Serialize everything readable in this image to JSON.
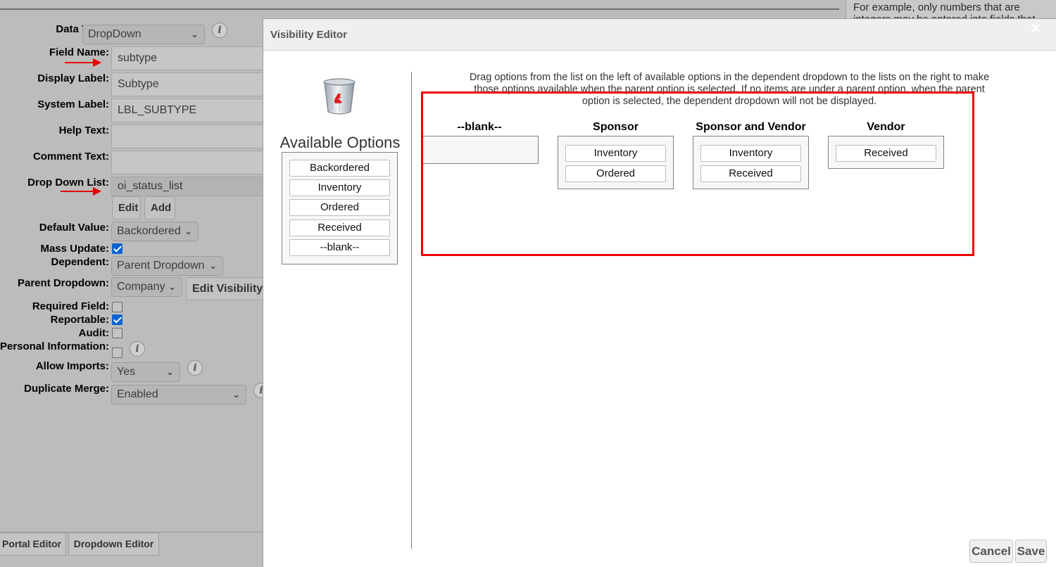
{
  "background": {
    "help_text": "For example, only numbers that are integers may be entered into fields that",
    "form": {
      "data_type": {
        "label": "Data Type:",
        "value": "DropDown"
      },
      "field_name": {
        "label": "Field Name:",
        "value": "subtype"
      },
      "display_label": {
        "label": "Display Label:",
        "value": "Subtype"
      },
      "system_label": {
        "label": "System Label:",
        "value": "LBL_SUBTYPE"
      },
      "help_text": {
        "label": "Help Text:",
        "value": ""
      },
      "comment_text": {
        "label": "Comment Text:",
        "value": ""
      },
      "drop_down_list": {
        "label": "Drop Down List:",
        "value": "oi_status_list",
        "edit": "Edit",
        "add": "Add"
      },
      "default_value": {
        "label": "Default Value:",
        "value": "Backordered"
      },
      "mass_update": {
        "label": "Mass Update:",
        "checked": true
      },
      "dependent": {
        "label": "Dependent:",
        "value": "Parent Dropdown"
      },
      "parent_dropdown": {
        "label": "Parent Dropdown:",
        "value": "Company",
        "edit_visibility": "Edit Visibility"
      },
      "required_field": {
        "label": "Required Field:",
        "checked": false
      },
      "reportable": {
        "label": "Reportable:",
        "checked": true
      },
      "audit": {
        "label": "Audit:",
        "checked": false
      },
      "personal_information": {
        "label": "Personal Information:",
        "checked": false
      },
      "allow_imports": {
        "label": "Allow Imports:",
        "value": "Yes"
      },
      "duplicate_merge": {
        "label": "Duplicate Merge:",
        "value": "Enabled"
      }
    },
    "bottom_buttons": [
      "Portal Editor",
      "Dropdown Editor"
    ]
  },
  "dialog": {
    "title": "Visibility Editor",
    "close": "×",
    "instructions": "Drag options from the list on the left of available options in the dependent dropdown to the lists on the right to make those options available when the parent option is selected. If no items are under a parent option, when the parent option is selected, the dependent dropdown will not be displayed.",
    "available": {
      "title": "Available Options",
      "options": [
        "Backordered",
        "Inventory",
        "Ordered",
        "Received",
        "--blank--"
      ]
    },
    "parent_options": [
      {
        "name": "--blank--",
        "items": []
      },
      {
        "name": "Sponsor",
        "items": [
          "Inventory",
          "Ordered"
        ]
      },
      {
        "name": "Sponsor and Vendor",
        "items": [
          "Inventory",
          "Received"
        ]
      },
      {
        "name": "Vendor",
        "items": [
          "Received"
        ]
      }
    ],
    "buttons": {
      "cancel": "Cancel",
      "save": "Save"
    }
  },
  "colors": {
    "highlight": "#ee0000",
    "checkbox": "#0b63d2"
  }
}
